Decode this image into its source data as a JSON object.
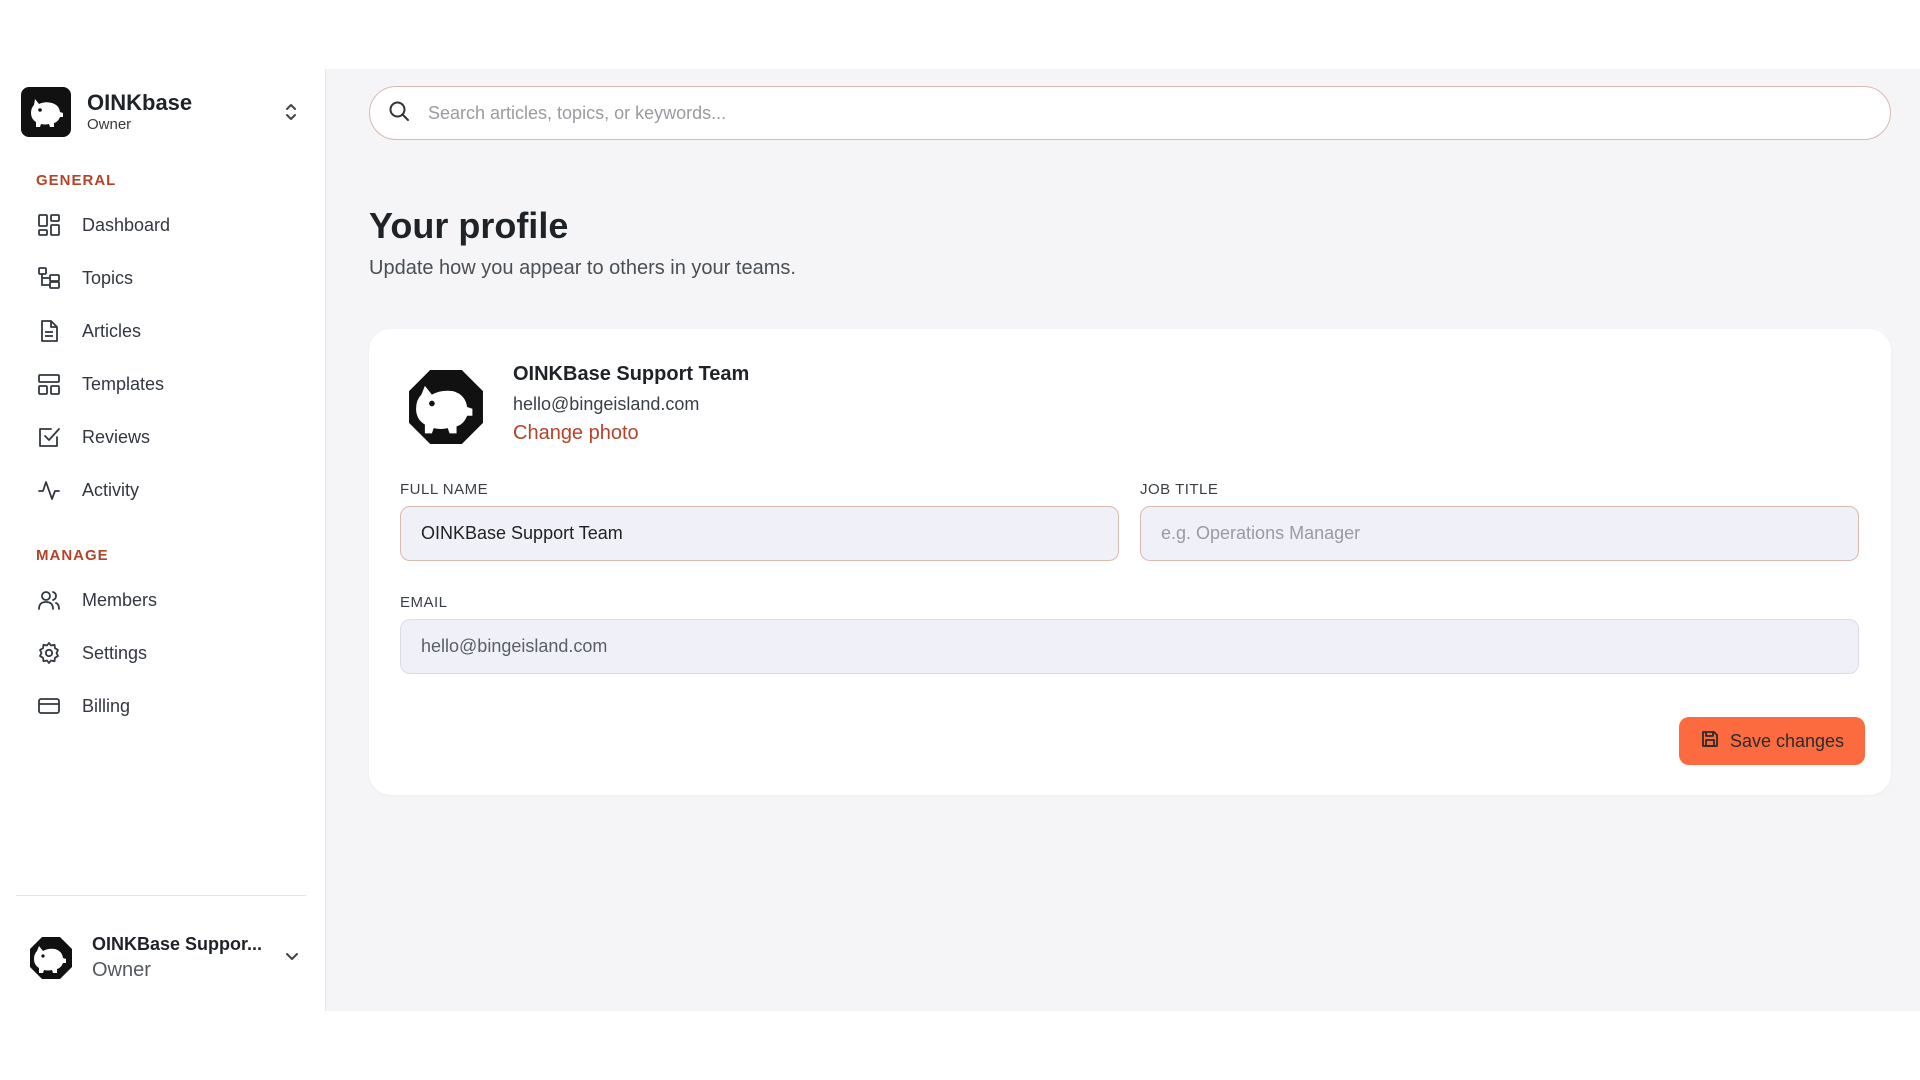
{
  "sidebar": {
    "org_name": "OINKbase",
    "org_role": "Owner",
    "general_label": "GENERAL",
    "general_items": [
      {
        "label": "Dashboard",
        "icon": "dashboard-icon"
      },
      {
        "label": "Topics",
        "icon": "topics-icon"
      },
      {
        "label": "Articles",
        "icon": "articles-icon"
      },
      {
        "label": "Templates",
        "icon": "templates-icon"
      },
      {
        "label": "Reviews",
        "icon": "reviews-icon"
      },
      {
        "label": "Activity",
        "icon": "activity-icon"
      }
    ],
    "manage_label": "MANAGE",
    "manage_items": [
      {
        "label": "Members",
        "icon": "members-icon"
      },
      {
        "label": "Settings",
        "icon": "gear-icon"
      },
      {
        "label": "Billing",
        "icon": "credit-card-icon"
      }
    ],
    "user_name": "OINKBase Suppor...",
    "user_role": "Owner"
  },
  "search": {
    "placeholder": "Search articles, topics, or keywords..."
  },
  "profile": {
    "title": "Your profile",
    "subtitle": "Update how you appear to others in your teams.",
    "display_name": "OINKBase Support Team",
    "email": "hello@bingeisland.com",
    "change_photo_label": "Change photo",
    "full_name_label": "FULL NAME",
    "full_name_value": "OINKBase Support Team",
    "job_title_label": "JOB TITLE",
    "job_title_placeholder": "e.g. Operations Manager",
    "email_label": "EMAIL",
    "email_value": "hello@bingeisland.com",
    "save_label": "Save changes"
  },
  "colors": {
    "accent": "#b5432a",
    "button": "#fb6b3f",
    "background": "#f5f5f7"
  }
}
